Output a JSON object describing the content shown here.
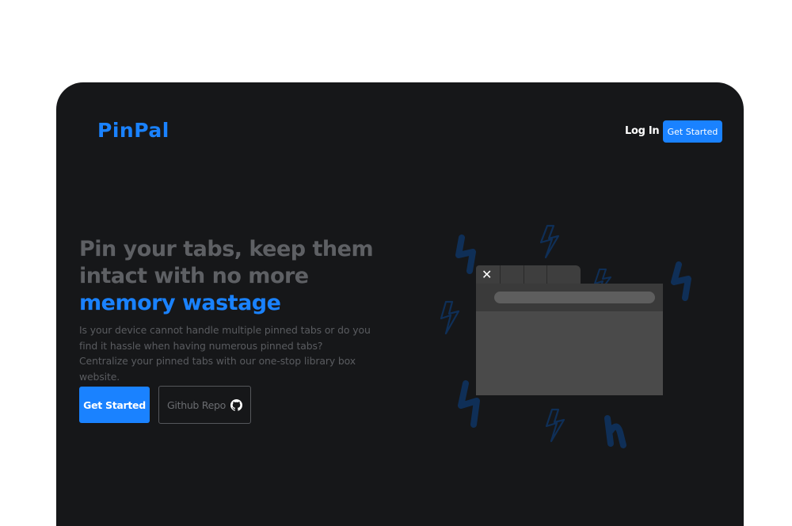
{
  "brand": {
    "logo_text": "PinPal"
  },
  "nav": {
    "login_label": "Log In",
    "cta_label": "Get Started"
  },
  "hero": {
    "headline_line1": "Pin your tabs, keep them",
    "headline_line2": "intact with no more",
    "headline_accent": "memory wastage",
    "description": "Is your device cannot handle multiple pinned tabs or do you find it hassle when having numerous pinned tabs? Centralize your pinned tabs with our one-stop library box website.",
    "primary_button": "Get Started",
    "secondary_button": "Github Repo",
    "secondary_icon": "github-icon"
  },
  "illustration": {
    "close_glyph": "✕"
  },
  "colors": {
    "accent": "#1a82ff",
    "background": "#161719",
    "doodle": "#0f2f57"
  }
}
